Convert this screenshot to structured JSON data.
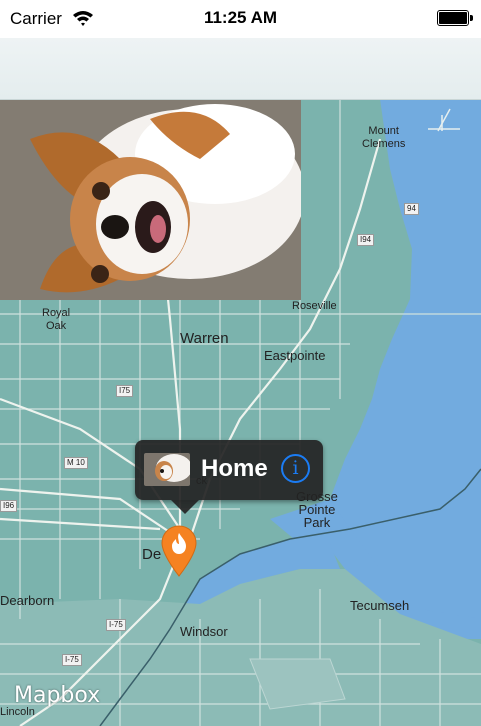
{
  "status_bar": {
    "carrier": "Carrier",
    "time": "11:25 AM"
  },
  "map": {
    "labels": {
      "mount_clemens": "Mount\nClemens",
      "royal_oak": "Royal\nOak",
      "warren": "Warren",
      "roseville": "Roseville",
      "eastpointe": "Eastpointe",
      "grosse_pointe_park": "Grosse\nPointe\nPark",
      "detroit_partial": "De",
      "dearborn": "Dearborn",
      "tecumseh": "Tecumseh",
      "windsor": "Windsor",
      "lincoln_partial": "Lincoln",
      "hamtramck_partial": "ck"
    },
    "shields": {
      "i94_top": "94",
      "i94_mid": "I94",
      "i75_mid": "I75",
      "i96": "I96",
      "m10": "M 10",
      "i75_south_a": "I-75",
      "i75_south_b": "I-75"
    },
    "attribution": "Mapbox"
  },
  "annotation": {
    "title": "Home",
    "info_glyph": "i"
  },
  "colors": {
    "water": "#72abdf",
    "land": "#7bb3ad",
    "land_south": "#8cbbb6",
    "pin": "#f58221",
    "info": "#1b7cf3"
  },
  "icons": {
    "wifi": "wifi-icon",
    "battery": "battery-icon",
    "pin": "map-pin-flame-icon",
    "info": "info-icon",
    "compass": "compass-icon"
  }
}
